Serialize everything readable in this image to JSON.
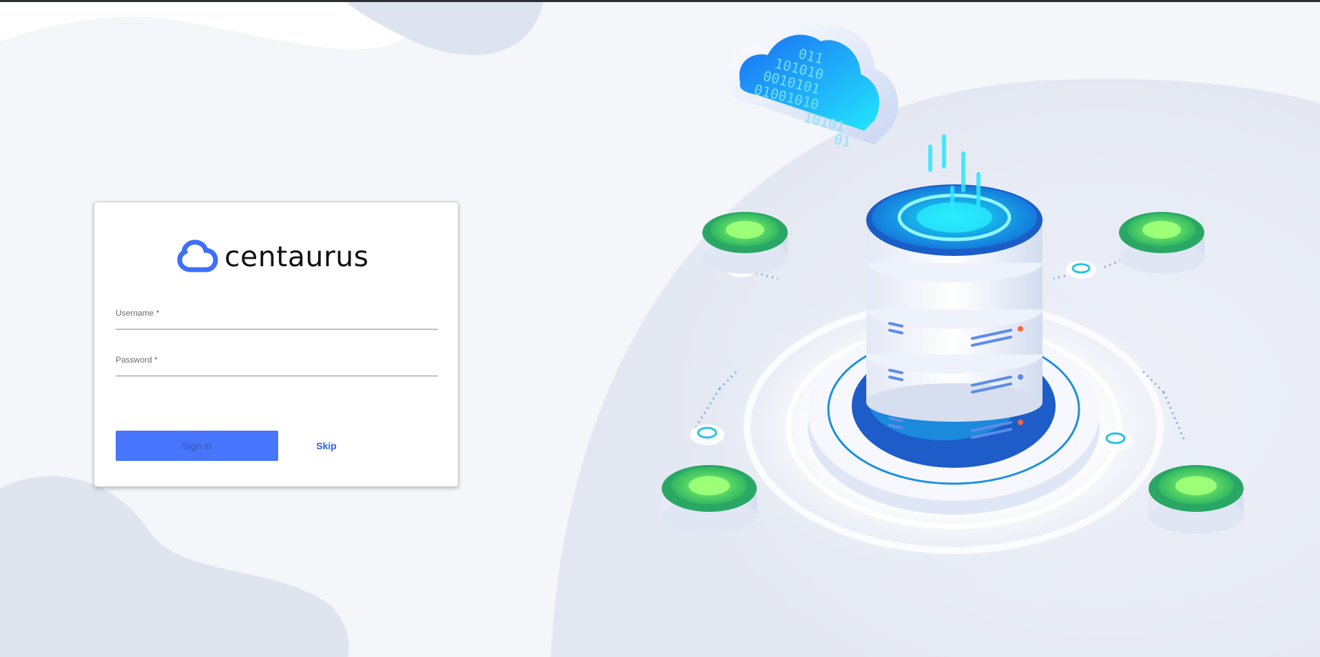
{
  "brand": {
    "name": "centaurus",
    "logo_icon": "cloud-outline-icon",
    "accent_color": "#3d6ff7"
  },
  "login_form": {
    "username": {
      "label": "Username *",
      "value": "",
      "placeholder": ""
    },
    "password": {
      "label": "Password *",
      "value": "",
      "placeholder": ""
    },
    "sign_in_label": "Sign in",
    "skip_label": "Skip",
    "sign_in_color": "#4776fc"
  },
  "illustration": {
    "cloud_text_rows": [
      "011",
      "101010",
      "0010101",
      "01001010",
      "10101",
      "01"
    ]
  }
}
